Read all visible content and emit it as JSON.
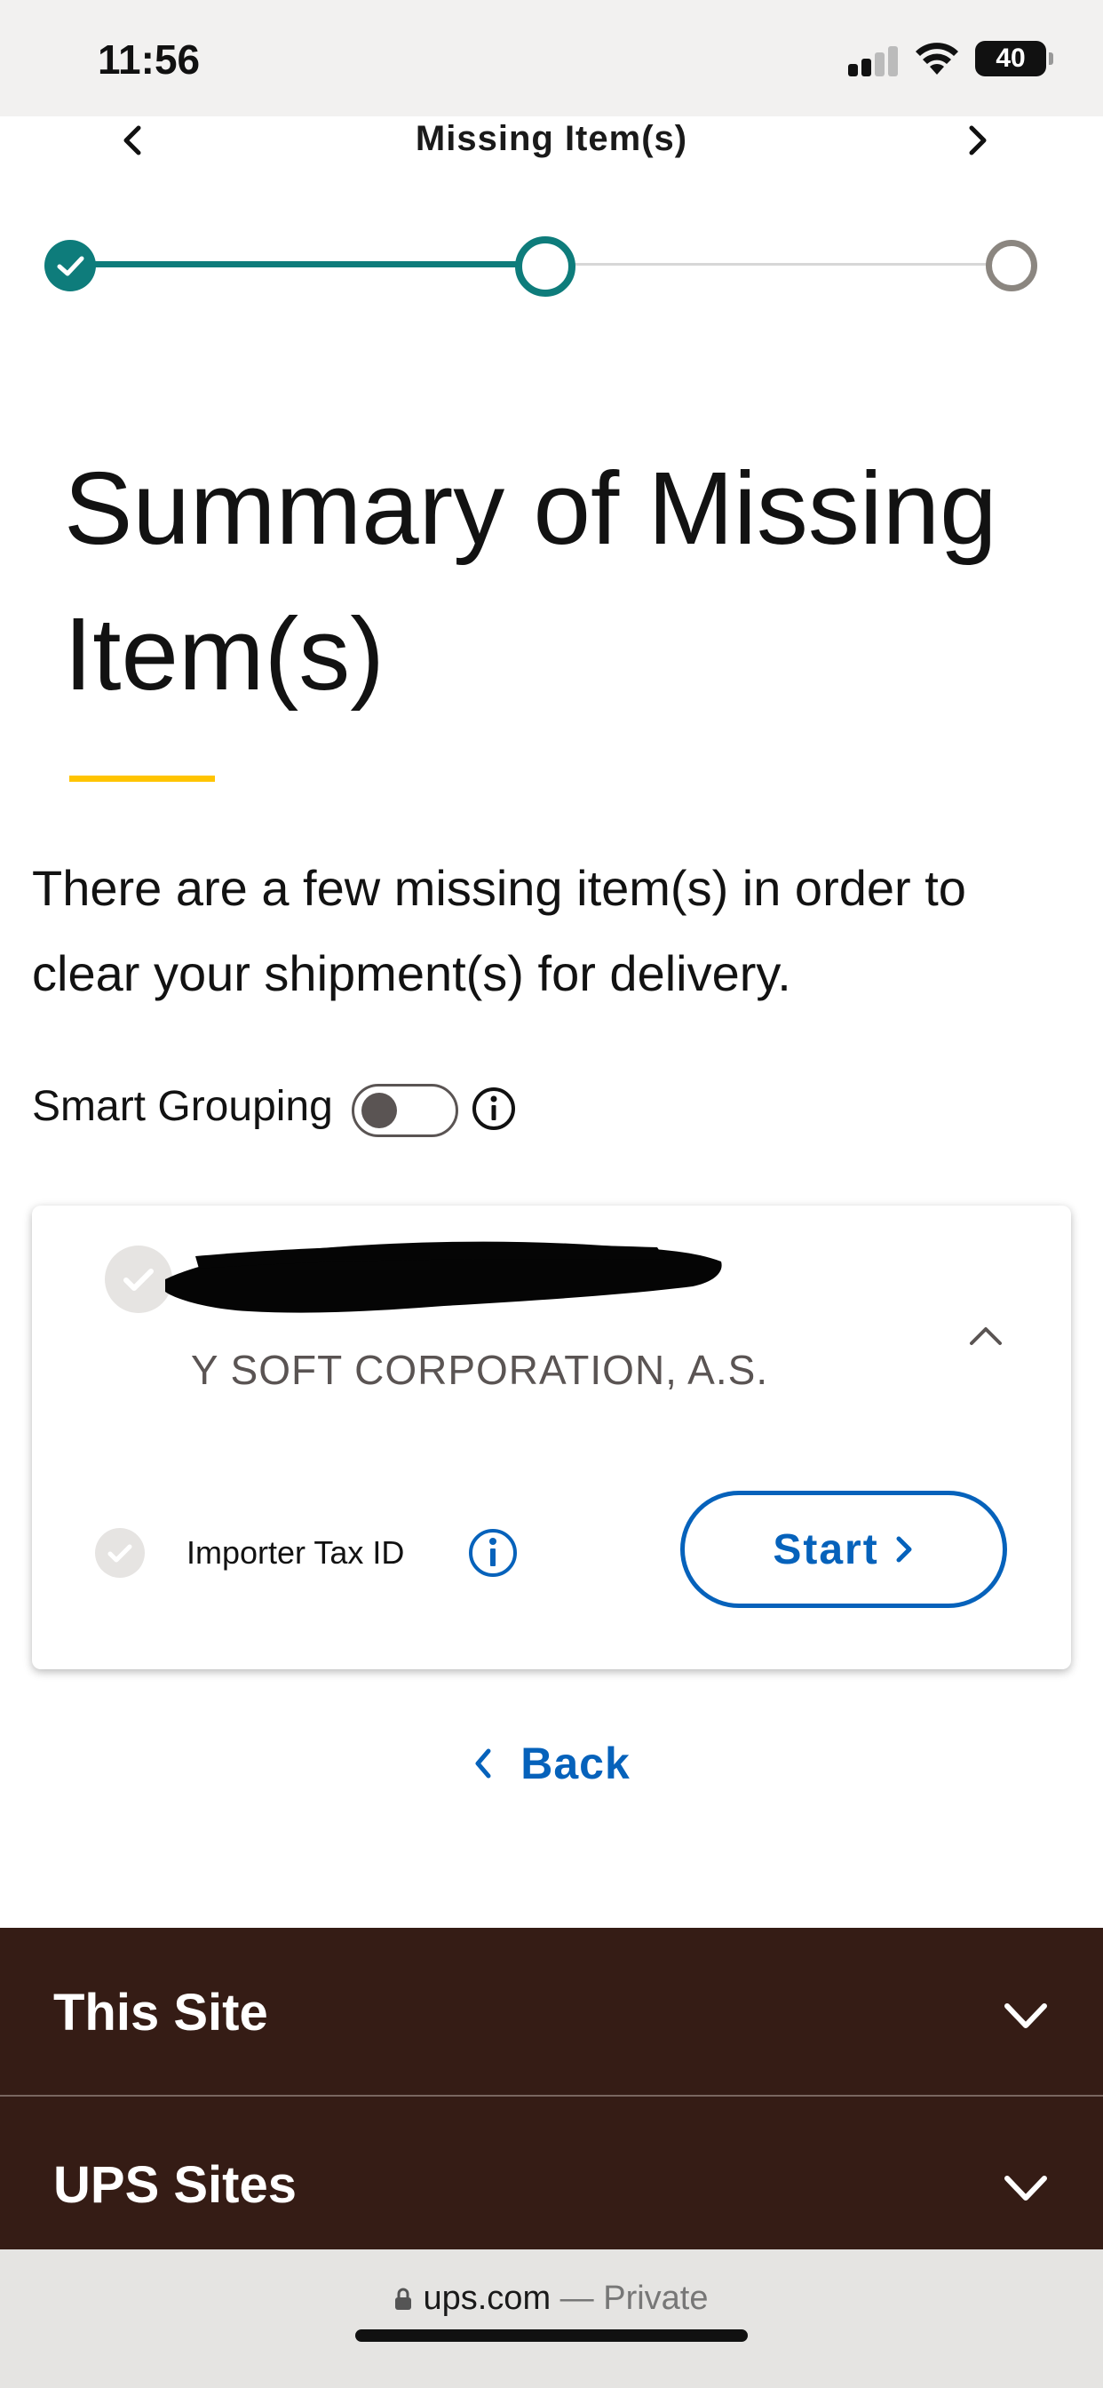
{
  "status_bar": {
    "time": "11:56",
    "battery": "40"
  },
  "header": {
    "title": "Missing Item(s)",
    "prev_icon": "chevron-left-icon",
    "next_icon": "chevron-right-icon"
  },
  "stepper": {
    "current_step": 2,
    "total_steps": 3,
    "colors": {
      "complete": "#0e7c7b",
      "pending": "#8b8680"
    }
  },
  "main": {
    "title": "Summary of Missing Item(s)",
    "intro": "There are a few missing item(s) in order to clear your shipment(s) for delivery.",
    "smart_grouping": {
      "label": "Smart Grouping",
      "enabled": false
    }
  },
  "card": {
    "company": "Y SOFT CORPORATION, A.S.",
    "task": {
      "label": "Importer Tax ID",
      "button": "Start"
    }
  },
  "back_link": "Back",
  "footer": {
    "rows": [
      {
        "label": "This Site"
      },
      {
        "label": "UPS Sites"
      }
    ]
  },
  "browser": {
    "domain": "ups.com",
    "separator": "—",
    "mode": "Private"
  },
  "colors": {
    "accent_blue": "#0662bb",
    "teal": "#0e7c7b",
    "gold": "#ffc400",
    "footer_brown": "#351c15"
  }
}
